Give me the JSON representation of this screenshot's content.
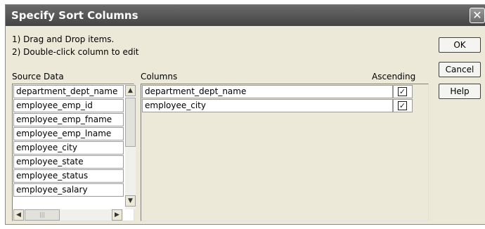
{
  "window": {
    "title": "Specify Sort Columns",
    "close_glyph": "✕"
  },
  "instructions": {
    "line1": "1) Drag and Drop items.",
    "line2": "2) Double-click column to edit"
  },
  "source": {
    "header": "Source Data",
    "items": [
      "department_dept_name",
      "employee_emp_id",
      "employee_emp_fname",
      "employee_emp_lname",
      "employee_city",
      "employee_state",
      "employee_status",
      "employee_salary"
    ]
  },
  "columns": {
    "header": "Columns",
    "ascending_header": "Ascending",
    "rows": [
      {
        "name": "department_dept_name",
        "ascending": true
      },
      {
        "name": "employee_city",
        "ascending": true
      }
    ]
  },
  "buttons": {
    "ok": "OK",
    "cancel": "Cancel",
    "help": "Help"
  },
  "icons": {
    "close": "close-icon",
    "scroll_up": "chevron-up-icon",
    "scroll_down": "chevron-down-icon",
    "scroll_left": "chevron-left-icon",
    "scroll_right": "chevron-right-icon",
    "check": "checkmark-icon"
  }
}
